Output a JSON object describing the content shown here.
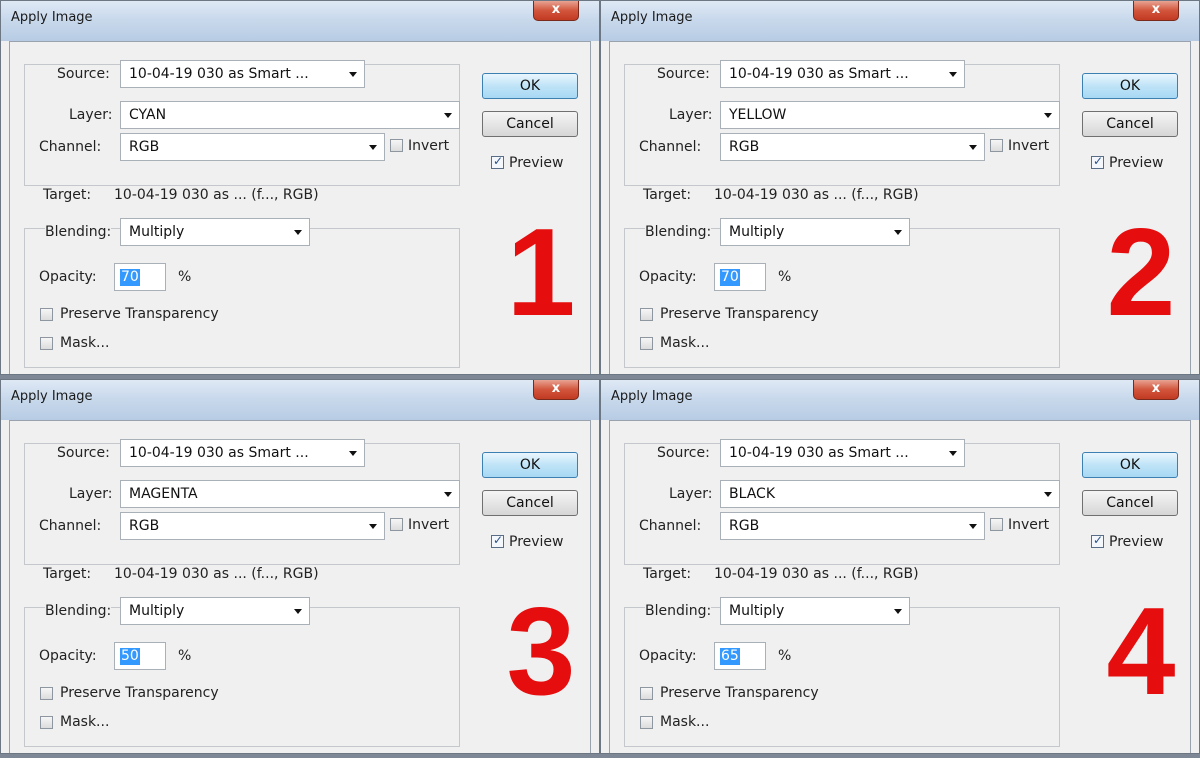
{
  "dialogs": [
    {
      "title": "Apply Image",
      "close_glyph": "x",
      "source_label": "Source:",
      "source_value": "10-04-19 030 as Smart ...",
      "layer_label": "Layer:",
      "layer_value": "CYAN",
      "channel_label": "Channel:",
      "channel_value": "RGB",
      "invert_label": "Invert",
      "invert_checked": false,
      "target_label": "Target:",
      "target_value": "10-04-19 030 as ... (f..., RGB)",
      "blending_label": "Blending:",
      "blending_value": "Multiply",
      "opacity_label": "Opacity:",
      "opacity_value": "70",
      "opacity_unit": "%",
      "preserve_label": "Preserve Transparency",
      "preserve_checked": false,
      "mask_label": "Mask...",
      "mask_checked": false,
      "ok_label": "OK",
      "cancel_label": "Cancel",
      "preview_label": "Preview",
      "preview_checked": true,
      "number": "1"
    },
    {
      "title": "Apply Image",
      "close_glyph": "x",
      "source_label": "Source:",
      "source_value": "10-04-19 030 as Smart ...",
      "layer_label": "Layer:",
      "layer_value": "YELLOW",
      "channel_label": "Channel:",
      "channel_value": "RGB",
      "invert_label": "Invert",
      "invert_checked": false,
      "target_label": "Target:",
      "target_value": "10-04-19 030 as ... (f..., RGB)",
      "blending_label": "Blending:",
      "blending_value": "Multiply",
      "opacity_label": "Opacity:",
      "opacity_value": "70",
      "opacity_unit": "%",
      "preserve_label": "Preserve Transparency",
      "preserve_checked": false,
      "mask_label": "Mask...",
      "mask_checked": false,
      "ok_label": "OK",
      "cancel_label": "Cancel",
      "preview_label": "Preview",
      "preview_checked": true,
      "number": "2"
    },
    {
      "title": "Apply Image",
      "close_glyph": "x",
      "source_label": "Source:",
      "source_value": "10-04-19 030 as Smart ...",
      "layer_label": "Layer:",
      "layer_value": "MAGENTA",
      "channel_label": "Channel:",
      "channel_value": "RGB",
      "invert_label": "Invert",
      "invert_checked": false,
      "target_label": "Target:",
      "target_value": "10-04-19 030 as ... (f..., RGB)",
      "blending_label": "Blending:",
      "blending_value": "Multiply",
      "opacity_label": "Opacity:",
      "opacity_value": "50",
      "opacity_unit": "%",
      "preserve_label": "Preserve Transparency",
      "preserve_checked": false,
      "mask_label": "Mask...",
      "mask_checked": false,
      "ok_label": "OK",
      "cancel_label": "Cancel",
      "preview_label": "Preview",
      "preview_checked": true,
      "number": "3"
    },
    {
      "title": "Apply Image",
      "close_glyph": "x",
      "source_label": "Source:",
      "source_value": "10-04-19 030 as Smart ...",
      "layer_label": "Layer:",
      "layer_value": "BLACK",
      "channel_label": "Channel:",
      "channel_value": "RGB",
      "invert_label": "Invert",
      "invert_checked": false,
      "target_label": "Target:",
      "target_value": "10-04-19 030 as ... (f..., RGB)",
      "blending_label": "Blending:",
      "blending_value": "Multiply",
      "opacity_label": "Opacity:",
      "opacity_value": "65",
      "opacity_unit": "%",
      "preserve_label": "Preserve Transparency",
      "preserve_checked": false,
      "mask_label": "Mask...",
      "mask_checked": false,
      "ok_label": "OK",
      "cancel_label": "Cancel",
      "preview_label": "Preview",
      "preview_checked": true,
      "number": "4"
    }
  ],
  "colors": {
    "number": "#e50d0d",
    "selection": "#3399ff",
    "default_button": "#bfe3f7"
  }
}
